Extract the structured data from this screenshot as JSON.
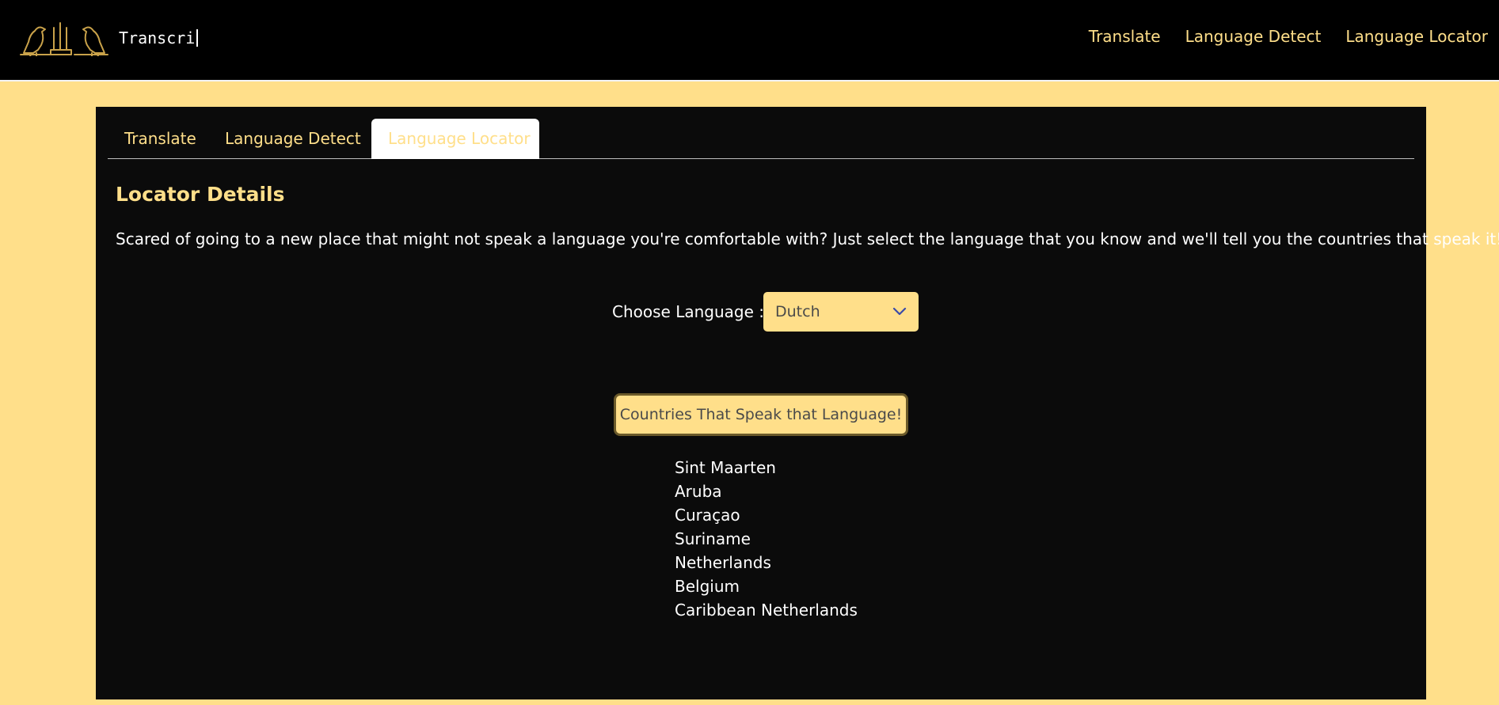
{
  "header": {
    "brand": "Transcri",
    "nav": [
      "Translate",
      "Language Detect",
      "Language Locator"
    ]
  },
  "tabs": [
    {
      "label": "Translate",
      "active": false
    },
    {
      "label": "Language Detect",
      "active": false
    },
    {
      "label": "Language Locator",
      "active": true
    }
  ],
  "locator": {
    "title": "Locator Details",
    "description": "Scared of going to a new place that might not speak a language you're comfortable with? Just select the language that you know and we'll tell you the countries that speak it!",
    "choose_label": "Choose Language :",
    "selected_language": "Dutch",
    "button_label": "Countries That Speak that Language!",
    "countries": [
      "Sint Maarten",
      "Aruba",
      "Curaçao",
      "Suriname",
      "Netherlands",
      "Belgium",
      "Caribbean Netherlands"
    ]
  },
  "colors": {
    "accent": "#FFDF8A",
    "navbar_bg": "#000000",
    "card_bg": "#0B0B0B",
    "text_light": "#FFFFFF",
    "chevron": "#3B4BA8"
  }
}
